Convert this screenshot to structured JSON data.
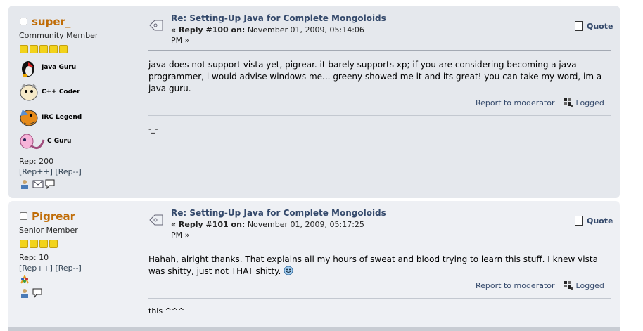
{
  "posts": [
    {
      "username": "super_",
      "rank": "Community Member",
      "stars": 5,
      "awards": [
        "Java Guru",
        "C++ Coder",
        "IRC Legend",
        "C Guru"
      ],
      "rep": "Rep: 200",
      "rep_plus": "[Rep++]",
      "rep_minus": "[Rep--]",
      "title": "Re: Setting-Up Java for Complete Mongoloids",
      "reply_label": "« Reply #100 on:",
      "date": "November 01, 2009, 05:14:06",
      "date_suffix": "PM »",
      "quote_label": "Quote",
      "body": "java does not support vista yet, pigrear. it barely supports xp; if you are considering becoming a java programmer, i would advise windows me... greeny showed me it and its great! you can take my word, im a java guru.",
      "report_label": "Report to moderator",
      "logged_label": "Logged",
      "signature": "-_-"
    },
    {
      "username": "Pigrear",
      "rank": "Senior Member",
      "stars": 4,
      "rep": "Rep: 10",
      "rep_plus": "[Rep++]",
      "rep_minus": "[Rep--]",
      "title": "Re: Setting-Up Java for Complete Mongoloids",
      "reply_label": "« Reply #101 on:",
      "date": "November 01, 2009, 05:17:25",
      "date_suffix": "PM »",
      "quote_label": "Quote",
      "body": "Hahah, alright thanks. That explains all my hours of sweat and blood trying to learn this stuff. I knew vista was shitty, just not THAT shitty.",
      "report_label": "Report to moderator",
      "logged_label": "Logged",
      "signature": "this ^^^"
    }
  ],
  "colors": {
    "username": "#c06c06",
    "link": "#34496b",
    "post_bg_a": "#e5e8ed",
    "post_bg_b": "#eef0f4"
  }
}
